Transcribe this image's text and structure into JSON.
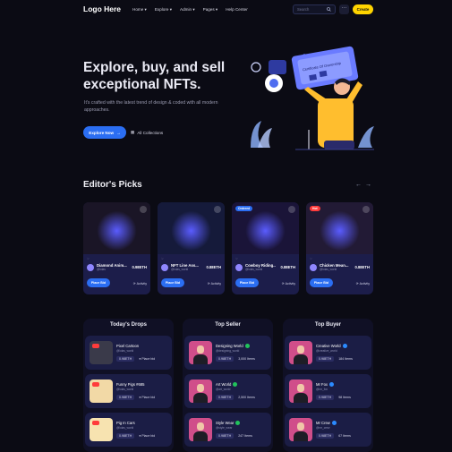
{
  "header": {
    "logo": "Logo Here",
    "nav": [
      "Home ▾",
      "Explore ▾",
      "Admin ▾",
      "Pages ▾",
      "Help Center"
    ],
    "search_placeholder": "Search",
    "search_icon": "search-icon",
    "more_icon": "more-dots-icon",
    "cta": "Create"
  },
  "hero": {
    "title": "Explore, buy, and sell exceptional NFTs.",
    "subtitle": "It's crafted with the latest trend of design & coded with all modern approaches.",
    "primary_button": "Explore Now",
    "secondary_link": "All Collections",
    "art_sign": "Certificate Of Ownership"
  },
  "editors_picks": {
    "title": "Editor's Picks",
    "cards": [
      {
        "badge": "",
        "badge_color": "",
        "name": "Diamond Anim...",
        "handle": "@lolas",
        "price": "0.98ETH",
        "bid_label": "Place Bid",
        "activity_label": "Activity",
        "img_bg": "#1a1526"
      },
      {
        "badge": "",
        "badge_color": "",
        "name": "NFT Line Ass...",
        "handle": "@lolas_world",
        "price": "0.88ETH",
        "bid_label": "Place Bid",
        "activity_label": "Activity",
        "img_bg": "#151a3a"
      },
      {
        "badge": "Ordered",
        "badge_color": "#2b6ef2",
        "name": "Cowboy Riding...",
        "handle": "@lolas_world",
        "price": "0.88ETH",
        "bid_label": "Place Bid",
        "activity_label": "Activity",
        "img_bg": "#1a1438"
      },
      {
        "badge": "Hot",
        "badge_color": "#ff3b3b",
        "name": "Chicken Mean...",
        "handle": "@lolas_world",
        "price": "0.88ETH",
        "bid_label": "Place Bid",
        "activity_label": "Activity",
        "img_bg": "#221a35"
      }
    ]
  },
  "todays_drops": {
    "title": "Today's Drops",
    "items": [
      {
        "name": "Pixel Cartoon",
        "handle": "@lolas_world",
        "price": "0.98ETH",
        "action": "Place bid",
        "thumb_bg": "#3a3a4a"
      },
      {
        "name": "Funny Pigs #685",
        "handle": "@lolas_world",
        "price": "0.98ETH",
        "action": "Place bid",
        "thumb_bg": "#f2d9a6"
      },
      {
        "name": "Pig In Cars",
        "handle": "@lolas_world",
        "price": "0.98ETH",
        "action": "Place bid",
        "thumb_bg": "#f7e3b0"
      }
    ]
  },
  "top_seller": {
    "title": "Top Seller",
    "items": [
      {
        "name": "Designing World",
        "handle": "@designing_world",
        "price": "0.98ETH",
        "items": "3,000 Items"
      },
      {
        "name": "Art World",
        "handle": "@art_world",
        "price": "0.98ETH",
        "items": "2,500 Items"
      },
      {
        "name": "Style Wear",
        "handle": "@style_wear",
        "price": "0.98ETH",
        "items": "247 Items"
      }
    ]
  },
  "top_buyer": {
    "title": "Top Buyer",
    "items": [
      {
        "name": "Creative World",
        "handle": "@creative_world",
        "price": "0.98ETH",
        "items": "184 Items"
      },
      {
        "name": "Mr Fox",
        "handle": "@mr_fox",
        "price": "0.98ETH",
        "items": "98 Items"
      },
      {
        "name": "Mr Crew",
        "handle": "@mr_crew",
        "price": "0.98ETH",
        "items": "67 Items"
      }
    ]
  }
}
